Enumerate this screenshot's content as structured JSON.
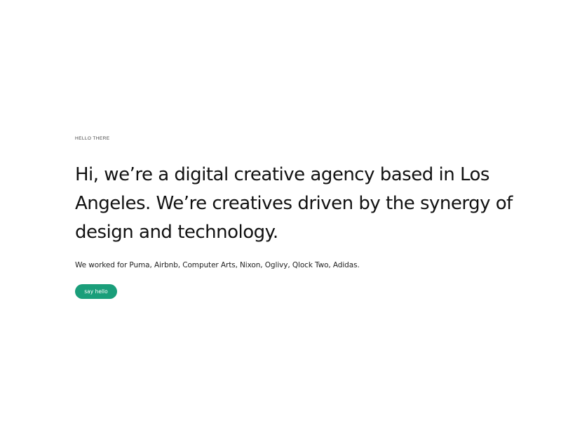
{
  "hero": {
    "eyebrow": "Hello there",
    "headline": "Hi, we’re a digital creative agency based in Los Angeles. We’re creatives driven by the synergy of design and technology.",
    "clients": "We worked for Puma, Airbnb, Computer Arts, Nixon, Oglivy, Qlock Two, Adidas.",
    "cta_label": "say hello"
  },
  "colors": {
    "accent": "#1a9e7a",
    "text": "#111111",
    "background": "#ffffff"
  }
}
